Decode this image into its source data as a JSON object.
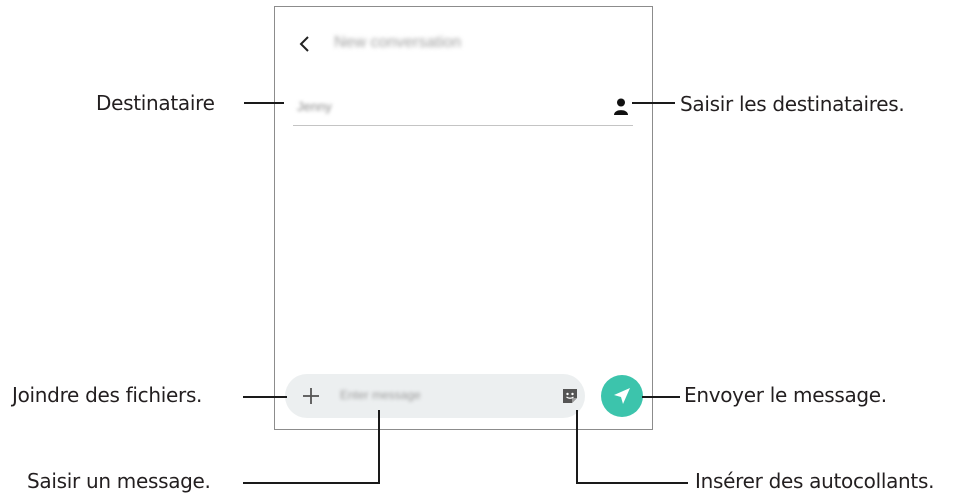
{
  "screen": {
    "title": "New conversation",
    "recipient_value": "Jenny",
    "message_placeholder": "Enter message"
  },
  "callouts": {
    "recipient": "Destinataire",
    "select_recipients": "Saisir les destinataires.",
    "attach": "Joindre des fichiers.",
    "send": "Envoyer le message.",
    "enter_message": "Saisir un message.",
    "stickers": "Insérer des autocollants."
  },
  "colors": {
    "send_button": "#3cc4ac",
    "compose_bar": "#eceff0"
  },
  "icons": {
    "back": "chevron-left-icon",
    "contact": "person-icon",
    "attach": "plus-icon",
    "sticker": "sticker-icon",
    "send": "paper-plane-icon"
  }
}
